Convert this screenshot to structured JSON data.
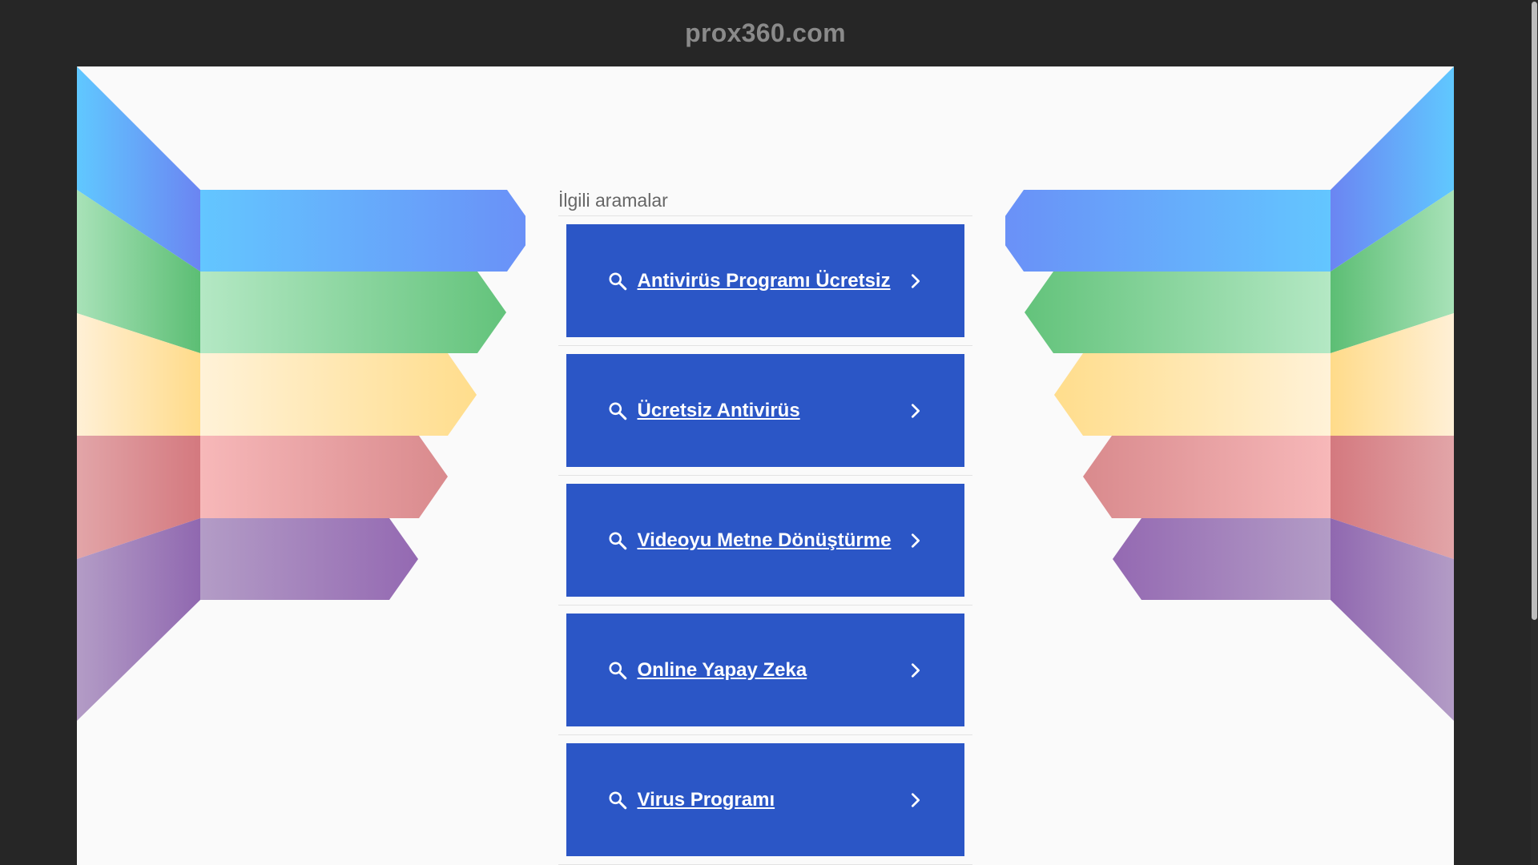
{
  "site": {
    "title": "prox360.com"
  },
  "related": {
    "header": "İlgili aramalar",
    "items": [
      {
        "label": "Antivirüs Programı Ücretsiz"
      },
      {
        "label": "Ücretsiz Antivirüs"
      },
      {
        "label": "Videoyu Metne Dönüştürme"
      },
      {
        "label": "Online Yapay Zeka"
      },
      {
        "label": "Virus Programı"
      }
    ]
  },
  "icons": {
    "search": "search-icon",
    "chevron": "chevron-right-icon"
  },
  "colors": {
    "page_bg": "#262626",
    "panel_bg": "#fafafa",
    "button_bg": "#2b56c6",
    "title": "#8a8a8a",
    "stripes": [
      "#5fbfff",
      "#6ccf84",
      "#ffdf8f",
      "#e38f95",
      "#9b72b8"
    ]
  }
}
